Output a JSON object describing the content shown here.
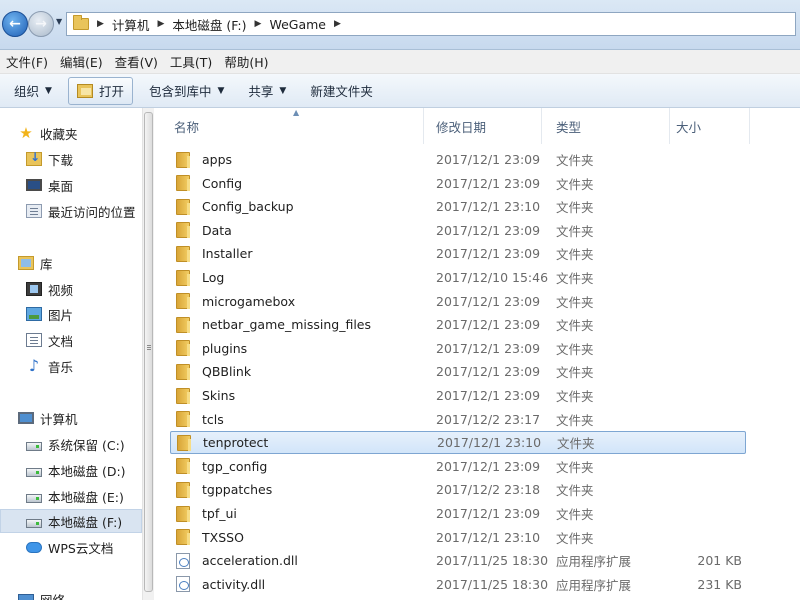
{
  "address": {
    "crumbs": [
      "计算机",
      "本地磁盘 (F:)",
      "WeGame"
    ]
  },
  "menu": [
    "文件(F)",
    "编辑(E)",
    "查看(V)",
    "工具(T)",
    "帮助(H)"
  ],
  "toolbar": {
    "organize": "组织",
    "open": "打开",
    "include_library": "包含到库中",
    "share": "共享",
    "new_folder": "新建文件夹"
  },
  "nav": {
    "favorites": "收藏夹",
    "downloads": "下载",
    "desktop": "桌面",
    "recent": "最近访问的位置",
    "libraries": "库",
    "videos": "视频",
    "pictures": "图片",
    "documents": "文档",
    "music": "音乐",
    "computer": "计算机",
    "drive_c": "系统保留 (C:)",
    "drive_d": "本地磁盘 (D:)",
    "drive_e": "本地磁盘 (E:)",
    "drive_f": "本地磁盘 (F:)",
    "wps_cloud": "WPS云文档",
    "network": "网络"
  },
  "columns": {
    "name": "名称",
    "modified": "修改日期",
    "type": "类型",
    "size": "大小"
  },
  "files": [
    {
      "name": "apps",
      "date": "2017/12/1 23:09",
      "type": "文件夹",
      "size": "",
      "kind": "folder"
    },
    {
      "name": "Config",
      "date": "2017/12/1 23:09",
      "type": "文件夹",
      "size": "",
      "kind": "folder"
    },
    {
      "name": "Config_backup",
      "date": "2017/12/1 23:10",
      "type": "文件夹",
      "size": "",
      "kind": "folder"
    },
    {
      "name": "Data",
      "date": "2017/12/1 23:09",
      "type": "文件夹",
      "size": "",
      "kind": "folder"
    },
    {
      "name": "Installer",
      "date": "2017/12/1 23:09",
      "type": "文件夹",
      "size": "",
      "kind": "folder"
    },
    {
      "name": "Log",
      "date": "2017/12/10 15:46",
      "type": "文件夹",
      "size": "",
      "kind": "folder"
    },
    {
      "name": "microgamebox",
      "date": "2017/12/1 23:09",
      "type": "文件夹",
      "size": "",
      "kind": "folder"
    },
    {
      "name": "netbar_game_missing_files",
      "date": "2017/12/1 23:09",
      "type": "文件夹",
      "size": "",
      "kind": "folder"
    },
    {
      "name": "plugins",
      "date": "2017/12/1 23:09",
      "type": "文件夹",
      "size": "",
      "kind": "folder"
    },
    {
      "name": "QBBlink",
      "date": "2017/12/1 23:09",
      "type": "文件夹",
      "size": "",
      "kind": "folder"
    },
    {
      "name": "Skins",
      "date": "2017/12/1 23:09",
      "type": "文件夹",
      "size": "",
      "kind": "folder"
    },
    {
      "name": "tcls",
      "date": "2017/12/2 23:17",
      "type": "文件夹",
      "size": "",
      "kind": "folder"
    },
    {
      "name": "tenprotect",
      "date": "2017/12/1 23:10",
      "type": "文件夹",
      "size": "",
      "kind": "folder",
      "selected": true
    },
    {
      "name": "tgp_config",
      "date": "2017/12/1 23:09",
      "type": "文件夹",
      "size": "",
      "kind": "folder"
    },
    {
      "name": "tgppatches",
      "date": "2017/12/2 23:18",
      "type": "文件夹",
      "size": "",
      "kind": "folder"
    },
    {
      "name": "tpf_ui",
      "date": "2017/12/1 23:09",
      "type": "文件夹",
      "size": "",
      "kind": "folder"
    },
    {
      "name": "TXSSO",
      "date": "2017/12/1 23:10",
      "type": "文件夹",
      "size": "",
      "kind": "folder"
    },
    {
      "name": "acceleration.dll",
      "date": "2017/11/25 18:30",
      "type": "应用程序扩展",
      "size": "201 KB",
      "kind": "dll"
    },
    {
      "name": "activity.dll",
      "date": "2017/11/25 18:30",
      "type": "应用程序扩展",
      "size": "231 KB",
      "kind": "dll"
    }
  ]
}
